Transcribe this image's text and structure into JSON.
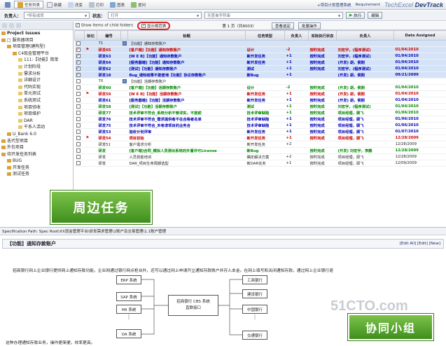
{
  "toolbar": {
    "items": [
      "",
      "任务列表",
      "新建",
      "改变",
      "打印",
      "图表",
      "提问"
    ],
    "right_link": "+项目计划管理系统",
    "brand": "TechExcel",
    "brand2": "DevTrack",
    "req": "Requirement"
  },
  "filter": {
    "owner_label": "负责人：",
    "owner_value": "*所有成员",
    "status_label": "状态：",
    "status_value": "打开",
    "view_value": "无查询字符串",
    "exec_label": "执行",
    "edit_label": "编辑"
  },
  "left": {
    "items": [
      {
        "t": "Project Issues",
        "d": 0
      },
      {
        "t": "□ 服务器项目",
        "d": 0
      },
      {
        "t": "项目管理(建构型)",
        "d": 1
      },
      {
        "t": "C4现金管理平台",
        "d": 2
      },
      {
        "t": "111:【功能】简单",
        "d": 3
      },
      {
        "t": "计划阶段",
        "d": 3
      },
      {
        "t": "需求分析",
        "d": 3
      },
      {
        "t": "详细设计",
        "d": 3
      },
      {
        "t": "代码实现",
        "d": 3
      },
      {
        "t": "单元测试",
        "d": 3
      },
      {
        "t": "系统测试",
        "d": 3
      },
      {
        "t": "项目验收",
        "d": 3
      },
      {
        "t": "项目维护",
        "d": 3
      },
      {
        "t": "DAR",
        "d": 3
      },
      {
        "t": "干系人活动",
        "d": 3
      },
      {
        "t": "U_Bank 6.0",
        "d": 1
      },
      {
        "t": "迭代型项目",
        "d": 0
      },
      {
        "t": "外包项目",
        "d": 0
      },
      {
        "t": "待开发任务列表",
        "d": 0
      },
      {
        "t": "BUG",
        "d": 1
      },
      {
        "t": "开发任务",
        "d": 1
      },
      {
        "t": "测试任务",
        "d": 1
      }
    ]
  },
  "main": {
    "show_items_label": "Show items of child folders",
    "milestone_label": "显示规范表",
    "page_info": "第 1 页（共8003）",
    "search_btn": "查看选定",
    "ops_btn": "批量操作",
    "columns": [
      "",
      "标记",
      "编号",
      "",
      "标题",
      "任务类型",
      "负责人",
      "实际执行状态",
      "负责人",
      "Date Assigned"
    ],
    "rows": [
      {
        "cls": "sel1",
        "c": "#222",
        "n": "71",
        "t": "【功能】通知存款账户",
        "type": "",
        "pri": "",
        "st": "",
        "own": "",
        "date": ""
      },
      {
        "cls": "sel1",
        "c": "#c00",
        "n": "研发65",
        "t": "[客户端]【功能】通知存款账户",
        "type": "设计",
        "pri": "-2",
        "st": "按时完成",
        "own": "刘宏宇，(程序测试)",
        "date": "01/04/2010"
      },
      {
        "cls": "sel1",
        "c": "#00b",
        "n": "研发63",
        "t": "[W E B]【功能】通知存款账户",
        "type": "新开发任务",
        "pri": "+1",
        "st": "按时完成",
        "own": "刘宏宇，(程序测试)",
        "date": "01/04/2010"
      },
      {
        "cls": "sel1",
        "c": "#00b",
        "n": "研发64",
        "t": "[服务器端]【功能】通知存款账户",
        "type": "新开发任务",
        "pri": "+1",
        "st": "按时完成",
        "own": "(开发) 胡，侯刚",
        "date": "01/04/2010"
      },
      {
        "cls": "sel1",
        "c": "#00b",
        "n": "研发62",
        "t": "[测试]【功能】通知存款账户",
        "type": "测试",
        "pri": "+1",
        "st": "按时完成",
        "own": "刘宏宇，(程序测试)",
        "date": "01/04/2010"
      },
      {
        "cls": "sel1",
        "c": "#00b",
        "n": "研发18",
        "t": "Bug_通知结果不能查询【功能】协议存款账户",
        "type": "新Bug",
        "pri": "+1",
        "st": "",
        "own": "(开发) 胡，侯刚",
        "date": "09/21/2009"
      },
      {
        "cls": "",
        "c": "#222",
        "n": "70",
        "t": "【功能】活期存款账户",
        "type": "",
        "pri": "",
        "st": "",
        "own": "",
        "date": ""
      },
      {
        "cls": "",
        "c": "#080",
        "n": "研发60",
        "t": "[客户端]【功能】活期存款账户",
        "type": "设计",
        "pri": "-2",
        "st": "按时完成",
        "own": "(开发) 胡，侯刚",
        "date": "01/04/2010"
      },
      {
        "cls": "",
        "c": "#c00",
        "n": "研发59",
        "t": "[W E B]【功能】活期存款账户",
        "type": "新开发任务",
        "pri": "+1",
        "st": "按时完成",
        "own": "(开发) 胡，侯刚",
        "date": "01/04/2010"
      },
      {
        "cls": "",
        "c": "#00b",
        "n": "研发61",
        "t": "[服务器端]【功能】活期存款账户",
        "type": "新开发任务",
        "pri": "+1",
        "st": "按时完成",
        "own": "(开发) 胡，侯刚",
        "date": "01/04/2010"
      },
      {
        "cls": "",
        "c": "#080",
        "n": "研发58",
        "t": "[测试]【功能】活期存款账户",
        "type": "测试",
        "pri": "+1",
        "st": "按时完成",
        "own": "刘宏宇，(程序测试)",
        "date": "01/04/2010"
      },
      {
        "cls": "",
        "c": "#080",
        "n": "研发77",
        "t": "技术评审不符合_系统分析不够详实，不能前",
        "type": "技术评审缺陷",
        "pri": "+1",
        "st": "按时完成",
        "own": "项目经理，顾飞",
        "date": "01/06/2010"
      },
      {
        "cls": "",
        "c": "#00b",
        "n": "研发76",
        "t": "技术评审不符合_需求提供者不在合格者名单",
        "type": "技术评审缺陷",
        "pri": "+1",
        "st": "按时完成",
        "own": "项目经理，顾飞",
        "date": "01/06/2010"
      },
      {
        "cls": "",
        "c": "#00b",
        "n": "研发75",
        "t": "技术评审不符合_未考虑项目的业务合",
        "type": "技术评审缺陷",
        "pri": "+1",
        "st": "按时完成",
        "own": "项目经理，顾飞",
        "date": "01/06/2010"
      },
      {
        "cls": "",
        "c": "#00b",
        "n": "研发53",
        "t": "验收计划评审",
        "type": "新开发任务",
        "pri": "+1",
        "st": "按时完成",
        "own": "项目经理，顾飞",
        "date": "01/07/2010"
      },
      {
        "cls": "",
        "c": "#c00",
        "n": "研发54",
        "t": "项目初始",
        "type": "新开发任务",
        "pri": "+1",
        "st": "按时完成",
        "own": "项目经理，顾飞",
        "date": "12/28/2009"
      },
      {
        "cls": "",
        "c": "#222",
        "n": "研发51",
        "t": "客户需求分析",
        "type": "新开发任务",
        "pri": "+2",
        "st": "",
        "own": "",
        "date": "12/28/2009"
      },
      {
        "cls": "",
        "c": "#080",
        "n": "研发",
        "t": "[客户端]合同_模拟人员测出系统的外置许可License",
        "type": "新Bug",
        "pri": "",
        "st": "按时完成",
        "own": "(开发) 刘宏宇，李鹏",
        "date": "12/28/2009"
      },
      {
        "cls": "",
        "c": "#222",
        "n": "研发",
        "t": "人员技能培训",
        "type": "确定解决方案",
        "pri": "+2",
        "st": "按时完成",
        "own": "项目经理，顾飞",
        "date": "12/28/2009"
      },
      {
        "cls": "",
        "c": "#222",
        "n": "研发",
        "t": "DAR_项目生命周期选型",
        "type": "新DAR任务",
        "pri": "+1",
        "st": "按时完成",
        "own": "项目经理，顾飞",
        "date": "12/09/2009"
      }
    ]
  },
  "spec": {
    "path": "Specification Path: Spec Root\\XX现金管理平台\\研发需求管理\\1账户及交易管理\\1.1账户管理"
  },
  "detail": {
    "title": "【功能】通知存款账户",
    "links": "[Edit All] [Edit] [New]",
    "desc": "招商银行网上企业银行提供网上通知存款功能，企业网通过银行网点柜台外，还可以通过网上申请开立通知存款账户并存入本金。在网上填写和关闭通知存款，通过网上企业银行退",
    "systems_left": [
      "ERP 系统",
      "SAP 系统",
      "HR 系统",
      "OA 系统"
    ],
    "center": "招商银行 CBS 系统\n直联接口",
    "systems_right": [
      "工商银行",
      "建设银行",
      "中国银行",
      "交通银行"
    ],
    "footer": "这种办理通知存款业务，操作更简便，效率更高。"
  },
  "callouts": {
    "peripheral": "周边任务",
    "collab": "协同小组"
  },
  "watermark": {
    "site": "51CTO.com",
    "sub": "技术成就梦想 Blog"
  }
}
